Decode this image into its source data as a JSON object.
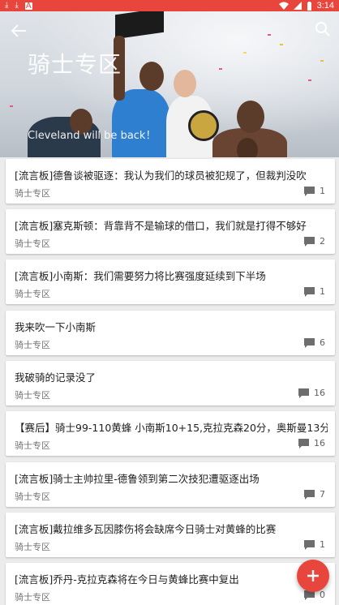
{
  "status_bar": {
    "time": "3:14",
    "left_icons": [
      "download-icon",
      "download-icon",
      "notification-a-icon"
    ],
    "right_icons": [
      "wifi-icon",
      "signal-icon",
      "battery-icon"
    ]
  },
  "header": {
    "title": "骑士专区",
    "subtitle": "Cleveland will be back！",
    "back_icon": "back-arrow-icon",
    "search_icon": "search-icon"
  },
  "colors": {
    "accent": "#e8453c",
    "background": "#ececec",
    "card": "#ffffff"
  },
  "posts": [
    {
      "title": "[流言板]德鲁谈被驱逐：我认为我们的球员被犯规了，但裁判没吹",
      "section": "骑士专区",
      "comments": "1"
    },
    {
      "title": "[流言板]塞克斯顿：背靠背不是输球的借口，我们就是打得不够好",
      "section": "骑士专区",
      "comments": "2"
    },
    {
      "title": "[流言板]小南斯：我们需要努力将比赛强度延续到下半场",
      "section": "骑士专区",
      "comments": "1"
    },
    {
      "title": "我来吹一下小南斯",
      "section": "骑士专区",
      "comments": "6"
    },
    {
      "title": "我破骑的记录没了",
      "section": "骑士专区",
      "comments": "16"
    },
    {
      "title": "【赛后】骑士99-110黄蜂 小南斯10+15,克拉克森20分，奥斯曼13分",
      "section": "骑士专区",
      "comments": "16"
    },
    {
      "title": "[流言板]骑士主帅拉里-德鲁领到第二次技犯遭驱逐出场",
      "section": "骑士专区",
      "comments": "7"
    },
    {
      "title": "[流言板]戴拉维多瓦因膝伤将会缺席今日骑士对黄蜂的比赛",
      "section": "骑士专区",
      "comments": "1"
    },
    {
      "title": "[流言板]乔丹-克拉克森将在今日与黄蜂比赛中复出",
      "section": "骑士专区",
      "comments": "0"
    }
  ],
  "fab": {
    "icon": "plus-icon"
  }
}
